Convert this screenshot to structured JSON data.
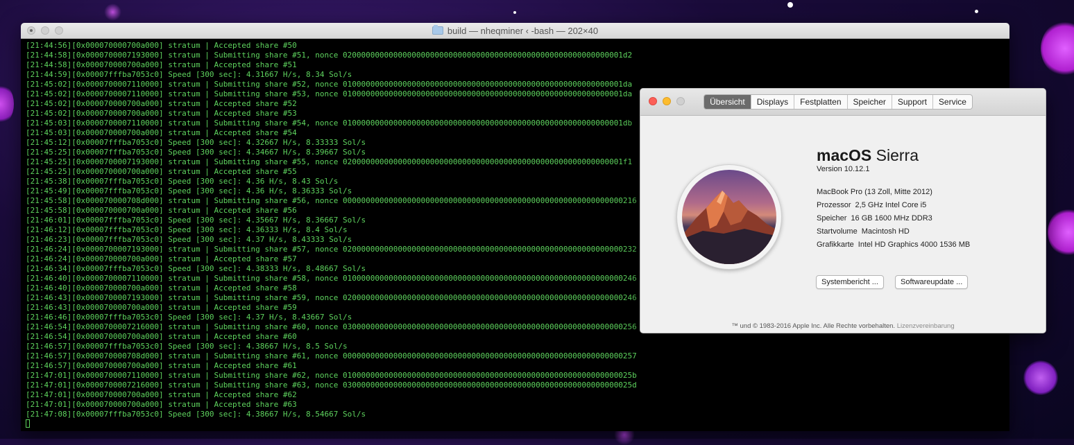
{
  "terminal": {
    "title": "build — nheqminer ‹ -bash — 202×40",
    "lines": [
      "[21:44:56][0x000070000700a000] stratum | Accepted share #50",
      "[21:44:58][0x0000700007193000] stratum | Submitting share #51, nonce 0200000000000000000000000000000000000000000000000000000000001d2",
      "[21:44:58][0x000070000700a000] stratum | Accepted share #51",
      "[21:44:59][0x00007fffba7053c0] Speed [300 sec]: 4.31667 H/s, 8.34 Sol/s",
      "[21:45:02][0x0000700007110000] stratum | Submitting share #52, nonce 0100000000000000000000000000000000000000000000000000000000001da",
      "[21:45:02][0x0000700007110000] stratum | Submitting share #53, nonce 0100000000000000000000000000000000000000000000000000000000001da",
      "[21:45:02][0x000070000700a000] stratum | Accepted share #52",
      "[21:45:02][0x000070000700a000] stratum | Accepted share #53",
      "[21:45:03][0x0000700007110000] stratum | Submitting share #54, nonce 0100000000000000000000000000000000000000000000000000000000001db",
      "[21:45:03][0x000070000700a000] stratum | Accepted share #54",
      "[21:45:12][0x00007fffba7053c0] Speed [300 sec]: 4.32667 H/s, 8.33333 Sol/s",
      "[21:45:25][0x00007fffba7053c0] Speed [300 sec]: 4.34667 H/s, 8.39667 Sol/s",
      "[21:45:25][0x0000700007193000] stratum | Submitting share #55, nonce 0200000000000000000000000000000000000000000000000000000000001f1",
      "[21:45:25][0x000070000700a000] stratum | Accepted share #55",
      "[21:45:38][0x00007fffba7053c0] Speed [300 sec]: 4.36 H/s, 8.43 Sol/s",
      "[21:45:49][0x00007fffba7053c0] Speed [300 sec]: 4.36 H/s, 8.36333 Sol/s",
      "[21:45:58][0x000070000708d000] stratum | Submitting share #56, nonce 0000000000000000000000000000000000000000000000000000000000000216",
      "[21:45:58][0x000070000700a000] stratum | Accepted share #56",
      "[21:46:01][0x00007fffba7053c0] Speed [300 sec]: 4.35667 H/s, 8.36667 Sol/s",
      "[21:46:12][0x00007fffba7053c0] Speed [300 sec]: 4.36333 H/s, 8.4 Sol/s",
      "[21:46:23][0x00007fffba7053c0] Speed [300 sec]: 4.37 H/s, 8.43333 Sol/s",
      "[21:46:24][0x0000700007193000] stratum | Submitting share #57, nonce 0200000000000000000000000000000000000000000000000000000000000232",
      "[21:46:24][0x000070000700a000] stratum | Accepted share #57",
      "[21:46:34][0x00007fffba7053c0] Speed [300 sec]: 4.38333 H/s, 8.48667 Sol/s",
      "[21:46:40][0x0000700007110000] stratum | Submitting share #58, nonce 0100000000000000000000000000000000000000000000000000000000000246",
      "[21:46:40][0x000070000700a000] stratum | Accepted share #58",
      "[21:46:43][0x0000700007193000] stratum | Submitting share #59, nonce 0200000000000000000000000000000000000000000000000000000000000246",
      "[21:46:43][0x000070000700a000] stratum | Accepted share #59",
      "[21:46:46][0x00007fffba7053c0] Speed [300 sec]: 4.37 H/s, 8.43667 Sol/s",
      "[21:46:54][0x0000700007216000] stratum | Submitting share #60, nonce 0300000000000000000000000000000000000000000000000000000000000256",
      "[21:46:54][0x000070000700a000] stratum | Accepted share #60",
      "[21:46:57][0x00007fffba7053c0] Speed [300 sec]: 4.38667 H/s, 8.5 Sol/s",
      "[21:46:57][0x000070000708d000] stratum | Submitting share #61, nonce 0000000000000000000000000000000000000000000000000000000000000257",
      "[21:46:57][0x000070000700a000] stratum | Accepted share #61",
      "[21:47:01][0x0000700007110000] stratum | Submitting share #62, nonce 010000000000000000000000000000000000000000000000000000000000025b",
      "[21:47:01][0x0000700007216000] stratum | Submitting share #63, nonce 030000000000000000000000000000000000000000000000000000000000025d",
      "[21:47:01][0x000070000700a000] stratum | Accepted share #62",
      "[21:47:01][0x000070000700a000] stratum | Accepted share #63",
      "[21:47:08][0x00007fffba7053c0] Speed [300 sec]: 4.38667 H/s, 8.54667 Sol/s"
    ]
  },
  "about": {
    "tabs": [
      "Übersicht",
      "Displays",
      "Festplatten",
      "Speicher",
      "Support",
      "Service"
    ],
    "active_tab": "Übersicht",
    "os_name_bold": "macOS",
    "os_name_rest": "Sierra",
    "version": "Version 10.12.1",
    "model": "MacBook Pro (13 Zoll, Mitte 2012)",
    "specs": [
      {
        "label": "Prozessor",
        "value": "2,5 GHz Intel Core i5"
      },
      {
        "label": "Speicher",
        "value": "16 GB 1600 MHz DDR3"
      },
      {
        "label": "Startvolume",
        "value": "Macintosh HD"
      },
      {
        "label": "Grafikkarte",
        "value": "Intel HD Graphics 4000 1536 MB"
      }
    ],
    "buttons": {
      "system_report": "Systembericht ...",
      "software_update": "Softwareupdate ..."
    },
    "footer_text": "™ und © 1983-2016 Apple Inc. Alle Rechte vorbehalten.",
    "footer_link": "Lizenzvereinbarung"
  },
  "colors": {
    "terminal_text": "#5ed35e",
    "desktop": "#1a0b3a",
    "active_tab": "#6b6b6b"
  }
}
